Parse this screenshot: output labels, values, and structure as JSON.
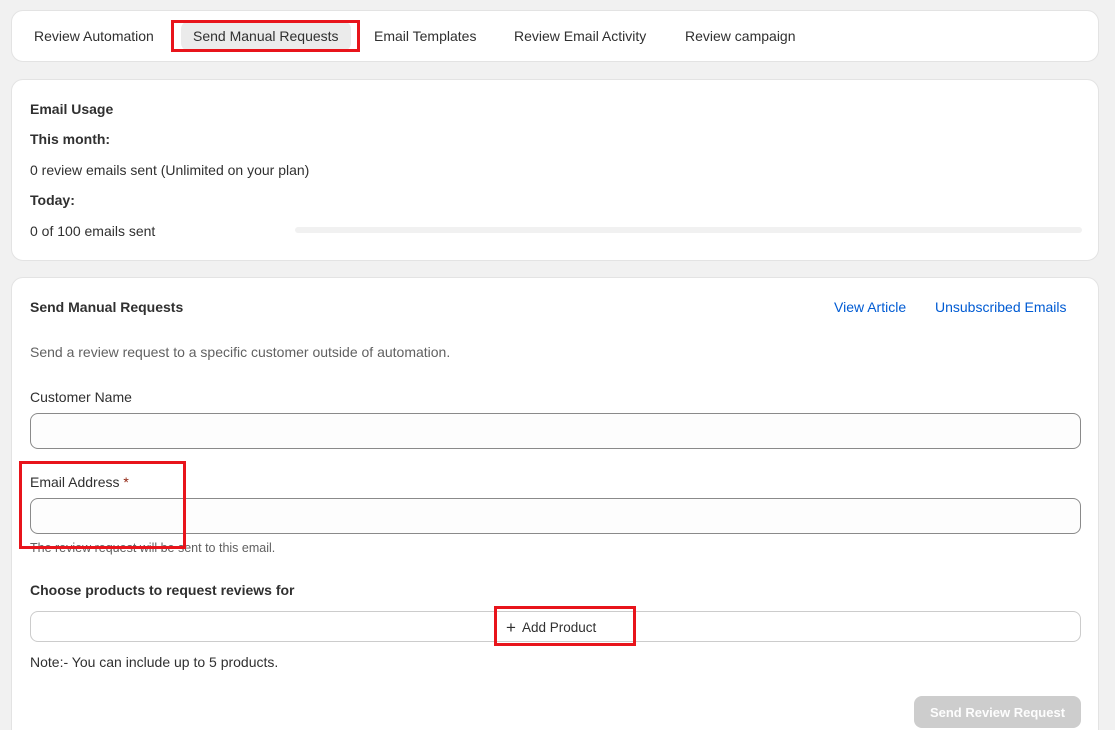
{
  "tabs": [
    {
      "label": "Review Automation",
      "active": false
    },
    {
      "label": "Send Manual Requests",
      "active": true
    },
    {
      "label": "Email Templates",
      "active": false
    },
    {
      "label": "Review Email Activity",
      "active": false
    },
    {
      "label": "Review campaign",
      "active": false
    }
  ],
  "usage": {
    "title": "Email Usage",
    "month_label": "This month:",
    "month_value": "0 review emails sent (Unlimited on your plan)",
    "today_label": "Today:",
    "today_value": "0 of 100 emails sent",
    "today_progress_fraction": 0
  },
  "send": {
    "title": "Send Manual Requests",
    "links": {
      "view_article": "View Article",
      "unsubscribed": "Unsubscribed Emails"
    },
    "description": "Send a review request to a specific customer outside of automation.",
    "customer_name_label": "Customer Name",
    "customer_name_value": "",
    "email_label": "Email Address",
    "required_marker": "*",
    "email_value": "",
    "email_help": "The review request will be sent to this email.",
    "products_label": "Choose products to request reviews for",
    "add_product_label": "Add Product",
    "note": "Note:- You can include up to 5 products.",
    "submit_label": "Send Review Request"
  },
  "colors": {
    "accent_link": "#005bd3",
    "highlight": "#e8141b",
    "required": "#8e1f0b",
    "disabled_button": "#cdcdcd"
  },
  "icons": {
    "add_product": "plus-icon"
  }
}
